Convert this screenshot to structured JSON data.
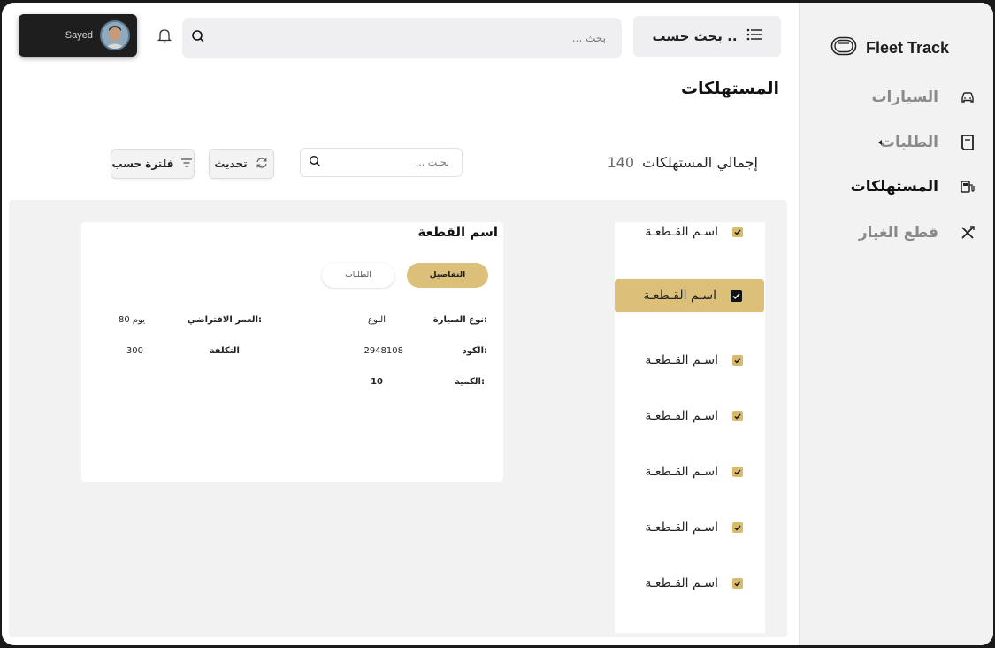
{
  "sidebar": {
    "logo_text": "Fleet Track",
    "items": [
      {
        "label": "السيارات",
        "icon": "car-icon",
        "active": false
      },
      {
        "label": "الطلبات",
        "icon": "document-icon",
        "active": false
      },
      {
        "label": "المستهلكات",
        "icon": "fuel-icon",
        "active": true
      },
      {
        "label": "قطع الغيار",
        "icon": "tools-icon",
        "active": false
      }
    ]
  },
  "header": {
    "user_name": "Sayed",
    "search_placeholder": "بحث ...",
    "search_by_label": "بحث حسب .."
  },
  "page": {
    "title": "المستهلكات",
    "total_label": "إجمالي المستهلكات",
    "total_count": "140",
    "search_placeholder": "بحـث ...",
    "refresh_label": "تحديث",
    "filter_label": "فلترة حسب"
  },
  "parts_list": [
    {
      "label": "اسـم القـطعـة",
      "checked": true,
      "selected": false
    },
    {
      "label": "اسـم القـطعـة",
      "checked": true,
      "selected": true
    },
    {
      "label": "اسـم القـطعـة",
      "checked": true,
      "selected": false
    },
    {
      "label": "اسـم القـطعـة",
      "checked": true,
      "selected": false
    },
    {
      "label": "اسـم القـطعـة",
      "checked": true,
      "selected": false
    },
    {
      "label": "اسـم القـطعـة",
      "checked": true,
      "selected": false
    },
    {
      "label": "اسـم القـطعـة",
      "checked": true,
      "selected": false
    }
  ],
  "detail": {
    "title": "اسم القطعة",
    "tab_details": "التفاصيل",
    "tab_orders": "الطلبات",
    "car_type_label": "نوع السيارة:",
    "car_type_value": "النوع",
    "lifespan_label": "العمر الافتراضي:",
    "lifespan_value": "80 يوم",
    "code_label": "الكود:",
    "code_value": "2948108",
    "cost_label": "التكلفة",
    "cost_value": "300",
    "quantity_label": "الكمية:",
    "quantity_value": "10"
  },
  "colors": {
    "accent": "#dcc07a",
    "dark": "#1e1e1e",
    "panel": "#f2f2f3"
  }
}
